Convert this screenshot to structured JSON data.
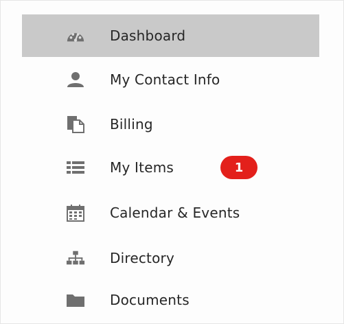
{
  "sidebar": {
    "items": [
      {
        "label": "Dashboard",
        "icon": "dashboard-icon",
        "active": true
      },
      {
        "label": "My Contact Info",
        "icon": "user-icon"
      },
      {
        "label": "Billing",
        "icon": "billing-icon"
      },
      {
        "label": "My Items",
        "icon": "list-icon",
        "badge": "1"
      },
      {
        "label": "Calendar & Events",
        "icon": "calendar-icon"
      },
      {
        "label": "Directory",
        "icon": "sitemap-icon"
      },
      {
        "label": "Documents",
        "icon": "folder-icon"
      }
    ]
  },
  "colors": {
    "active_background": "#c9c9c9",
    "icon_gray": "#6f6f6f",
    "badge_red": "#e3201b"
  }
}
